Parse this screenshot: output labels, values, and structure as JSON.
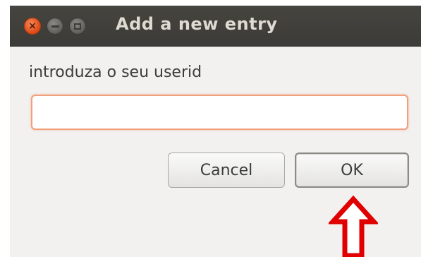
{
  "window": {
    "title": "Add a new entry",
    "controls": {
      "close_icon": "close-icon",
      "minimize_icon": "minimize-icon",
      "maximize_icon": "maximize-icon"
    }
  },
  "dialog": {
    "prompt": "introduza o seu userid",
    "input": {
      "value": "",
      "placeholder": ""
    },
    "buttons": {
      "cancel_label": "Cancel",
      "ok_label": "OK"
    }
  },
  "annotation": {
    "arrow_icon": "arrow-up-icon",
    "color": "#e00000"
  },
  "colors": {
    "titlebar": "#3c3b37",
    "title_text": "#dfdbd2",
    "close_button": "#dd4814",
    "dialog_bg": "#f2f1f0",
    "input_focus_border": "#f0a07a"
  }
}
